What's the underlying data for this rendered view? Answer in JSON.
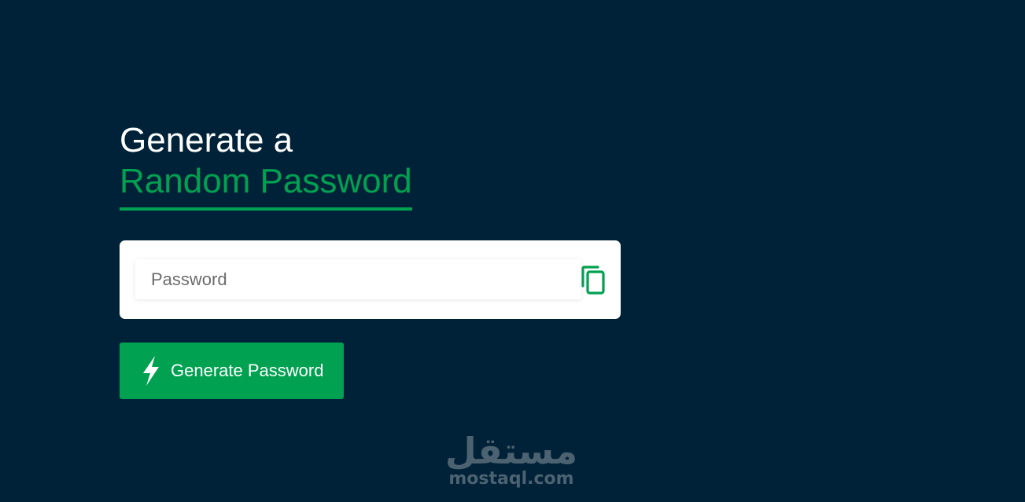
{
  "hero": {
    "title_line1": "Generate a",
    "title_line2": "Random Password"
  },
  "password_field": {
    "placeholder": "Password",
    "value": ""
  },
  "copy_button": {
    "icon": "copy-icon"
  },
  "generate_button": {
    "label": "Generate Password",
    "icon": "lightning-bolt-icon"
  },
  "watermark": {
    "arabic": "مستقل",
    "latin": "mostaql.com"
  },
  "colors": {
    "background": "#002239",
    "accent": "#00a150",
    "card": "#ffffff",
    "watermark": "#4c6271"
  }
}
